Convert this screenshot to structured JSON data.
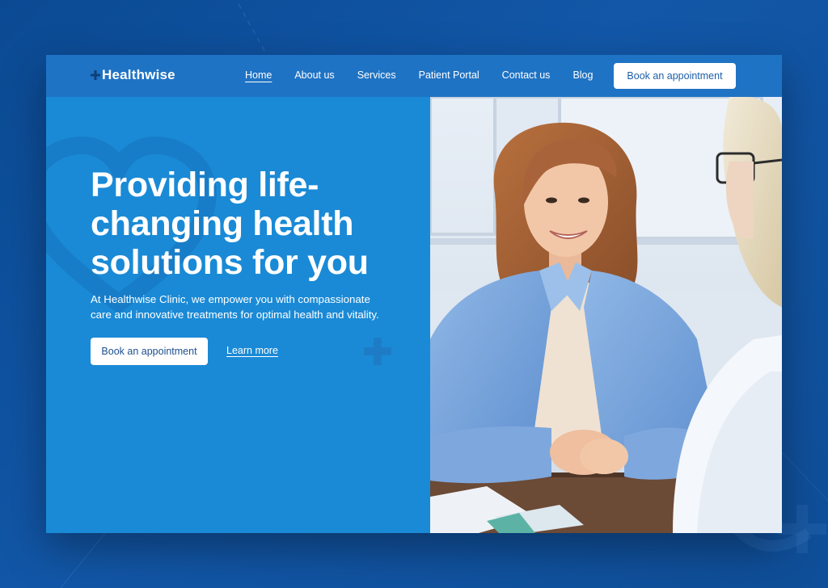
{
  "brand": {
    "name": "Healthwise",
    "icon": "plus-icon"
  },
  "nav": {
    "links": [
      {
        "label": "Home",
        "active": true
      },
      {
        "label": "About us",
        "active": false
      },
      {
        "label": "Services",
        "active": false
      },
      {
        "label": "Patient Portal",
        "active": false
      },
      {
        "label": "Contact us",
        "active": false
      },
      {
        "label": "Blog",
        "active": false
      }
    ],
    "cta_label": "Book an appointment"
  },
  "hero": {
    "title_lines": [
      "Providing life-",
      "changing health",
      "solutions for you"
    ],
    "description_lines": [
      "At Healthwise Clinic, we empower you with compassionate",
      "care and innovative treatments for optimal health and vitality."
    ],
    "primary_cta": "Book an appointment",
    "secondary_cta": "Learn more"
  },
  "colors": {
    "page_bg": "#0f4e98",
    "nav_bg": "#1f73c4",
    "hero_bg": "#1a8ad6",
    "button_text": "#1d5fa8",
    "white": "#ffffff"
  }
}
